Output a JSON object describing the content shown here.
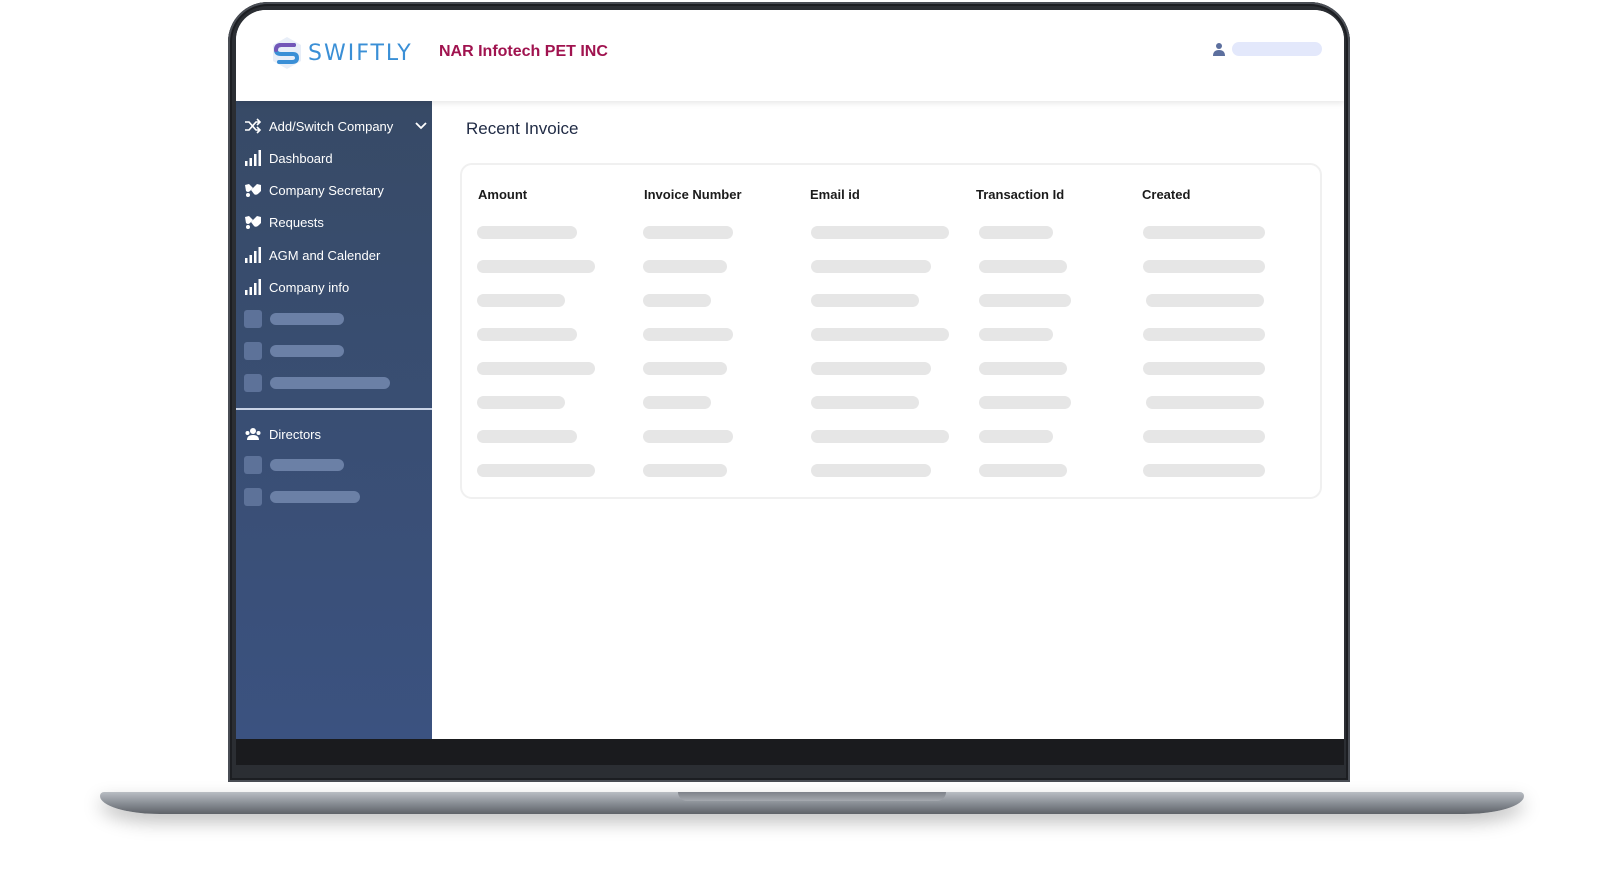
{
  "header": {
    "logo_text": "SWIFTLY",
    "company_name": "NAR Infotech PET INC"
  },
  "sidebar": {
    "items": [
      {
        "label": "Add/Switch Company",
        "icon": "shuffle-icon"
      },
      {
        "label": "Dashboard",
        "icon": "bar-chart-icon"
      },
      {
        "label": "Company Secretary",
        "icon": "handshake-icon"
      },
      {
        "label": "Requests",
        "icon": "handshake-icon"
      },
      {
        "label": "AGM and Calender",
        "icon": "bar-chart-icon"
      },
      {
        "label": "Company info",
        "icon": "bar-chart-icon"
      }
    ],
    "section2_items": [
      {
        "label": "Directors",
        "icon": "users-icon"
      }
    ]
  },
  "main": {
    "title": "Recent Invoice",
    "columns": [
      "Amount",
      "Invoice Number",
      "Email id",
      "Transaction Id",
      "Created"
    ]
  },
  "colors": {
    "accent": "#3a8fd6",
    "company_name": "#a0134f",
    "sidebar_top": "#374a66",
    "sidebar_bottom": "#3b5280",
    "skeleton": "#e6e6e6"
  }
}
